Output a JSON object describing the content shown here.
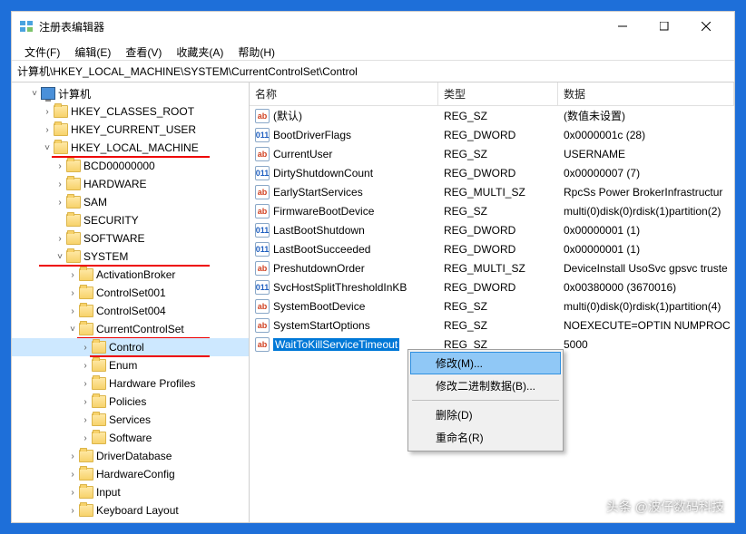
{
  "window": {
    "title": "注册表编辑器"
  },
  "menu": {
    "file": "文件(F)",
    "edit": "编辑(E)",
    "view": "查看(V)",
    "favorites": "收藏夹(A)",
    "help": "帮助(H)"
  },
  "path": "计算机\\HKEY_LOCAL_MACHINE\\SYSTEM\\CurrentControlSet\\Control",
  "tree": {
    "root": "计算机",
    "hkcr": "HKEY_CLASSES_ROOT",
    "hkcu": "HKEY_CURRENT_USER",
    "hklm": "HKEY_LOCAL_MACHINE",
    "bcd": "BCD00000000",
    "hw": "HARDWARE",
    "sam": "SAM",
    "sec": "SECURITY",
    "sw": "SOFTWARE",
    "sys": "SYSTEM",
    "ab": "ActivationBroker",
    "cs1": "ControlSet001",
    "cs4": "ControlSet004",
    "ccs": "CurrentControlSet",
    "ctrl": "Control",
    "enum": "Enum",
    "hp": "Hardware Profiles",
    "pol": "Policies",
    "srv": "Services",
    "sw2": "Software",
    "dd": "DriverDatabase",
    "hc": "HardwareConfig",
    "inp": "Input",
    "kl": "Keyboard Layout"
  },
  "list": {
    "headers": {
      "name": "名称",
      "type": "类型",
      "data": "数据"
    },
    "rows": [
      {
        "icon": "str",
        "name": "(默认)",
        "type": "REG_SZ",
        "data": "(数值未设置)"
      },
      {
        "icon": "bin",
        "name": "BootDriverFlags",
        "type": "REG_DWORD",
        "data": "0x0000001c (28)"
      },
      {
        "icon": "str",
        "name": "CurrentUser",
        "type": "REG_SZ",
        "data": "USERNAME"
      },
      {
        "icon": "bin",
        "name": "DirtyShutdownCount",
        "type": "REG_DWORD",
        "data": "0x00000007 (7)"
      },
      {
        "icon": "str",
        "name": "EarlyStartServices",
        "type": "REG_MULTI_SZ",
        "data": "RpcSs Power BrokerInfrastructur"
      },
      {
        "icon": "str",
        "name": "FirmwareBootDevice",
        "type": "REG_SZ",
        "data": "multi(0)disk(0)rdisk(1)partition(2)"
      },
      {
        "icon": "bin",
        "name": "LastBootShutdown",
        "type": "REG_DWORD",
        "data": "0x00000001 (1)"
      },
      {
        "icon": "bin",
        "name": "LastBootSucceeded",
        "type": "REG_DWORD",
        "data": "0x00000001 (1)"
      },
      {
        "icon": "str",
        "name": "PreshutdownOrder",
        "type": "REG_MULTI_SZ",
        "data": "DeviceInstall UsoSvc gpsvc truste"
      },
      {
        "icon": "bin",
        "name": "SvcHostSplitThresholdInKB",
        "type": "REG_DWORD",
        "data": "0x00380000 (3670016)"
      },
      {
        "icon": "str",
        "name": "SystemBootDevice",
        "type": "REG_SZ",
        "data": "multi(0)disk(0)rdisk(1)partition(4)"
      },
      {
        "icon": "str",
        "name": "SystemStartOptions",
        "type": "REG_SZ",
        "data": " NOEXECUTE=OPTIN  NUMPROC"
      },
      {
        "icon": "str",
        "name": "WaitToKillServiceTimeout",
        "type": "REG_SZ",
        "data": "5000",
        "selected": true
      }
    ]
  },
  "context": {
    "modify": "修改(M)...",
    "modifyBin": "修改二进制数据(B)...",
    "delete": "删除(D)",
    "rename": "重命名(R)"
  },
  "watermark": "头条 @波仔数码科技"
}
